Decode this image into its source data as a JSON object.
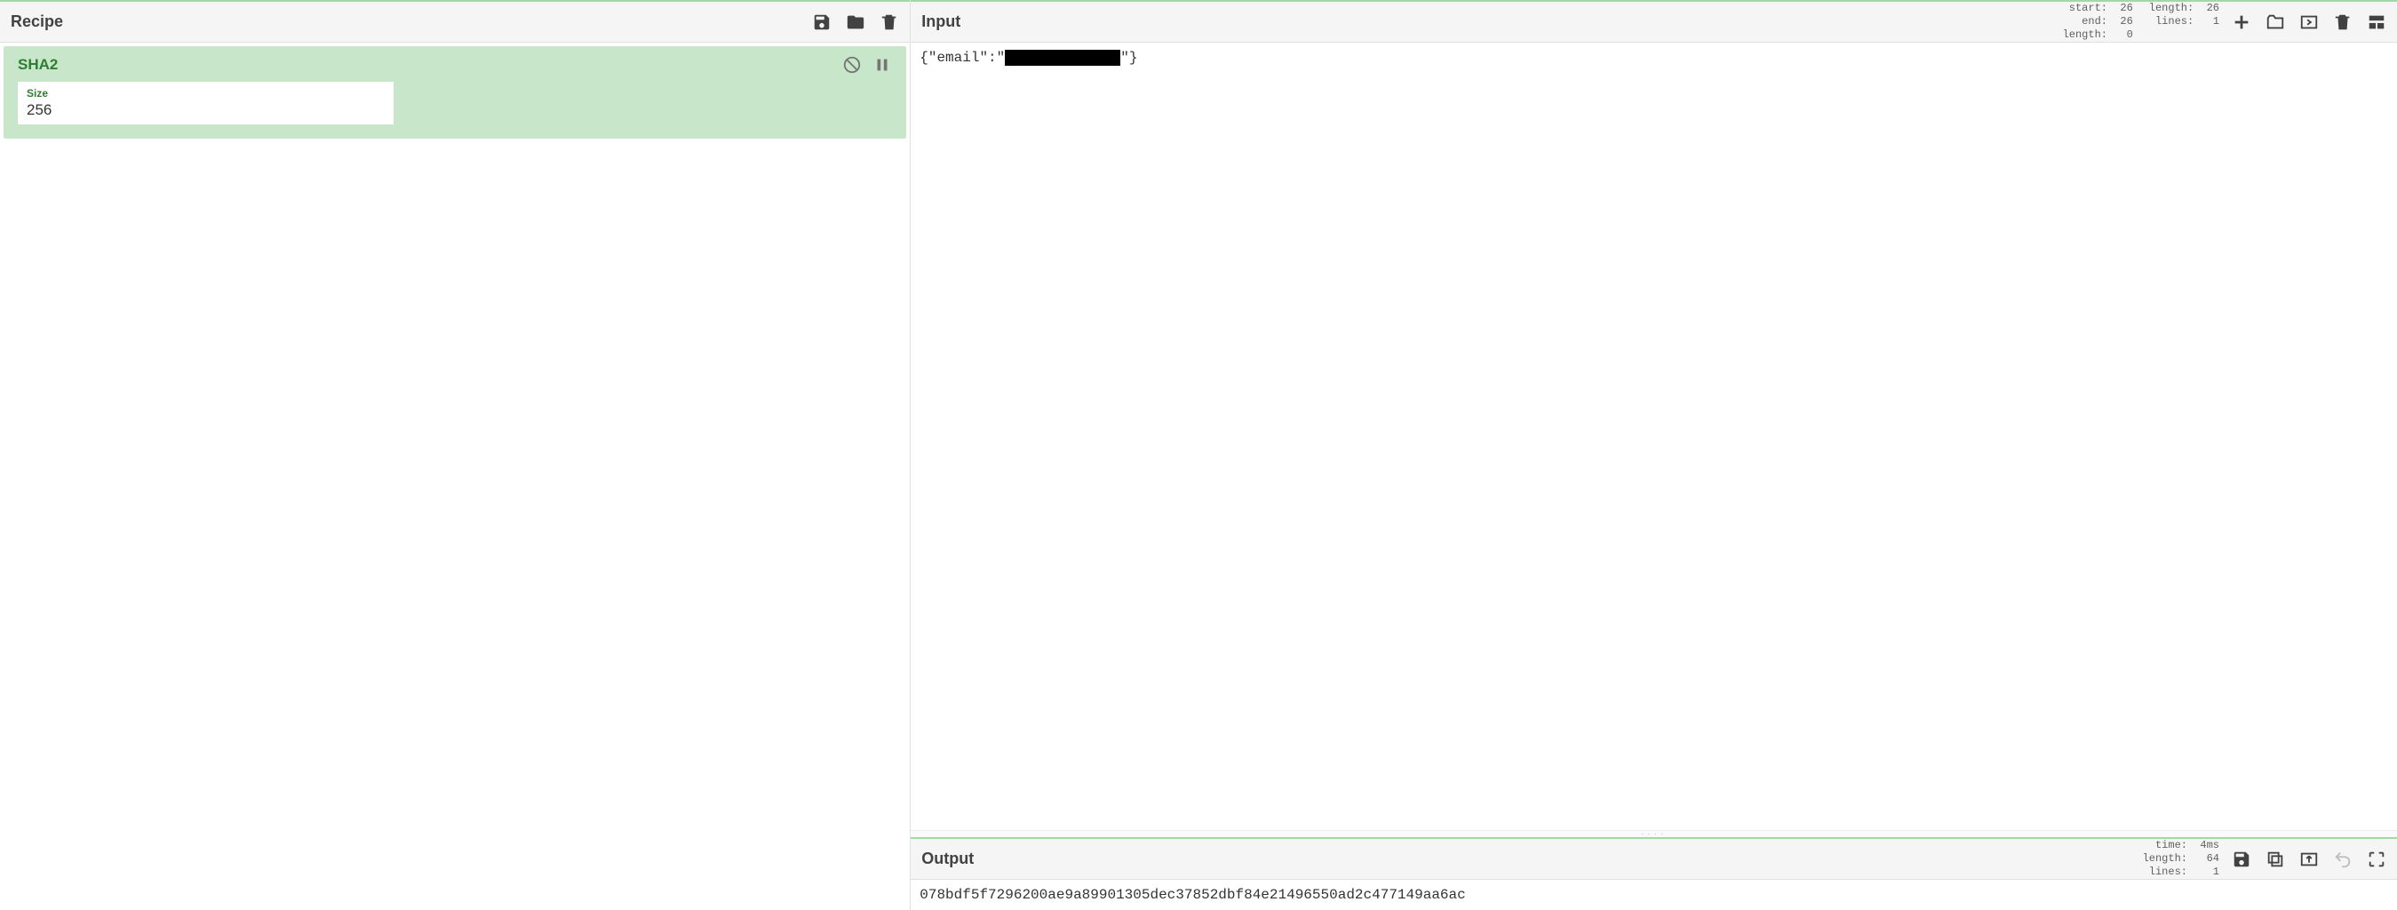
{
  "recipe": {
    "title": "Recipe",
    "operation": {
      "name": "SHA2",
      "arg_label": "Size",
      "arg_value": "256"
    }
  },
  "input": {
    "title": "Input",
    "text_pre": "{\"email\":\"",
    "text_post": "\"}",
    "stats": {
      "col1": "start:  26\n   end:  26\nlength:   0",
      "col2": "length:  26\n lines:   1"
    }
  },
  "output": {
    "title": "Output",
    "text": "078bdf5f7296200ae9a89901305dec37852dbf84e21496550ad2c477149aa6ac",
    "stats": {
      "col1": "  time:  4ms\nlength:   64\n lines:    1"
    }
  }
}
